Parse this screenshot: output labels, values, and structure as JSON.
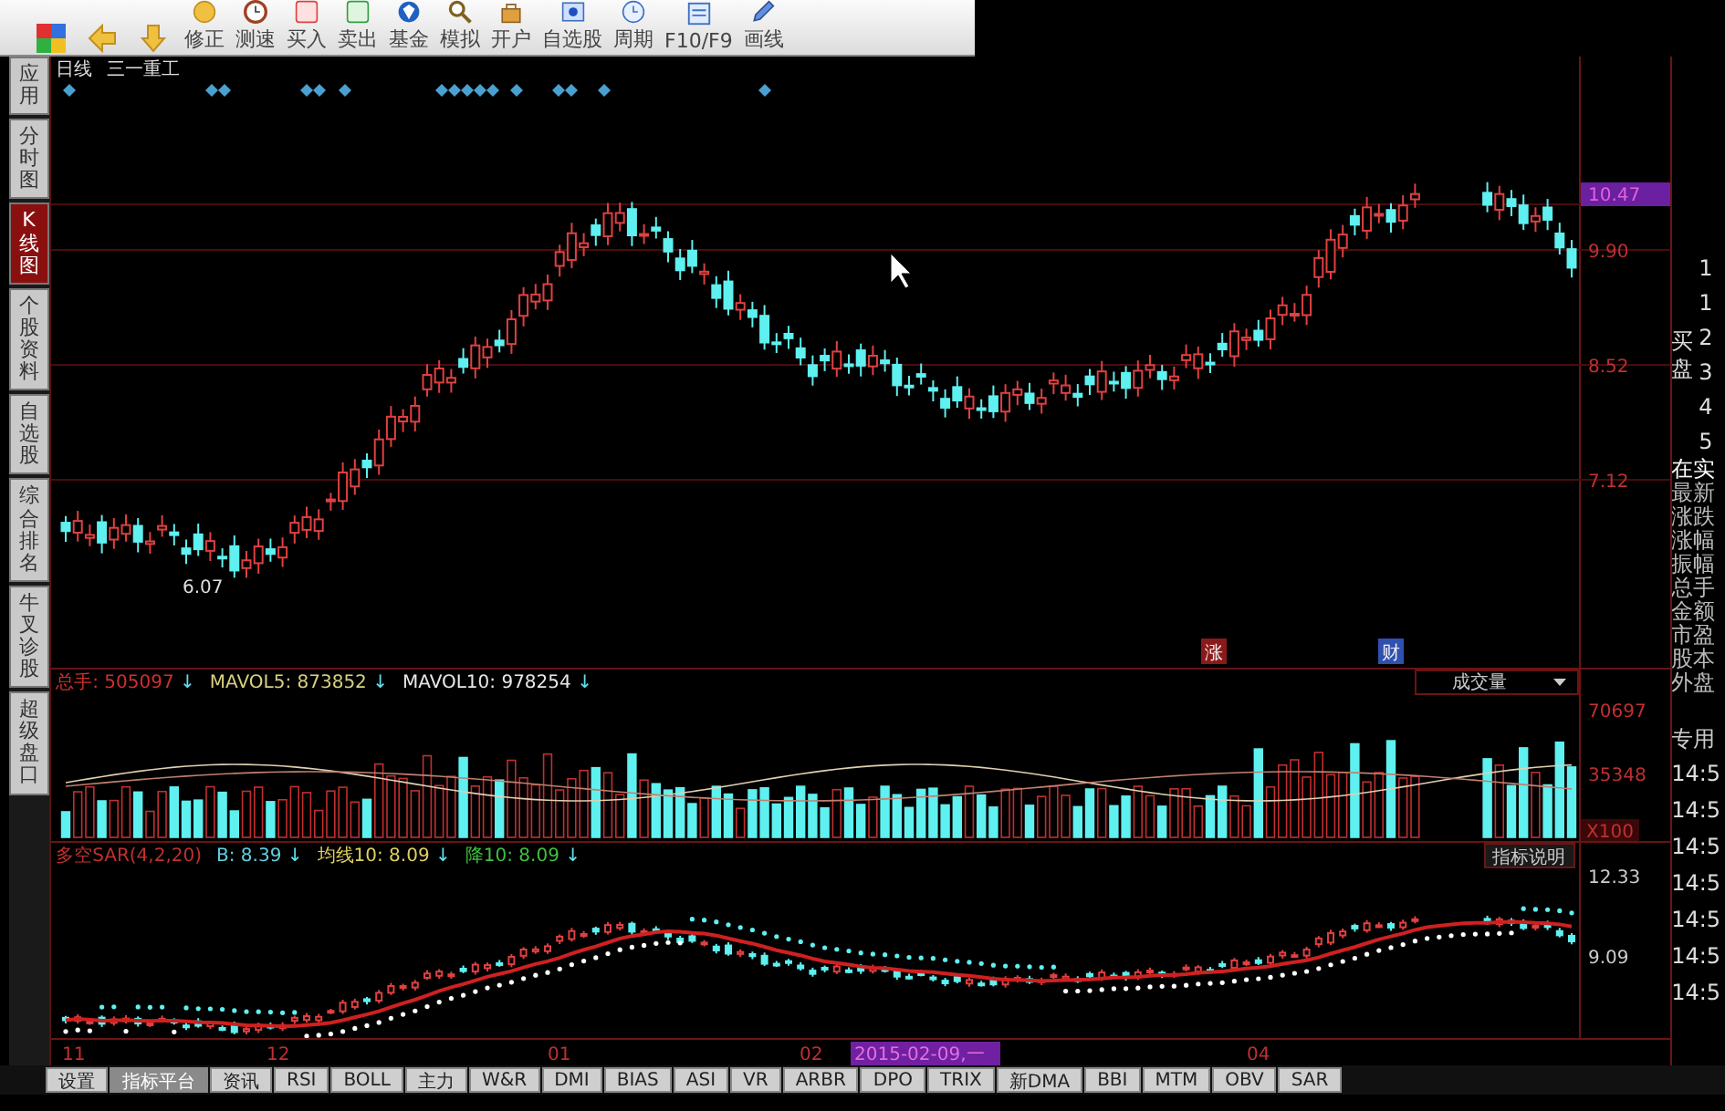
{
  "toolbar": {
    "buttons": [
      {
        "kind": "grid"
      },
      {
        "kind": "back"
      },
      {
        "kind": "updown"
      },
      {
        "kind": "fix",
        "label": "修正"
      },
      {
        "kind": "speed",
        "label": "测速"
      },
      {
        "kind": "buy",
        "label": "买入"
      },
      {
        "kind": "sell",
        "label": "卖出"
      },
      {
        "kind": "fund",
        "label": "基金"
      },
      {
        "kind": "sim",
        "label": "模拟"
      },
      {
        "kind": "account",
        "label": "开户"
      },
      {
        "kind": "watch",
        "label": "自选股"
      },
      {
        "kind": "period",
        "label": "周期"
      },
      {
        "kind": "f10",
        "label": "F10/F9"
      },
      {
        "kind": "draw",
        "label": "画线"
      }
    ]
  },
  "side_tabs": [
    {
      "label": "应用",
      "selected": false
    },
    {
      "label": "分时图",
      "selected": false
    },
    {
      "label": "K线图",
      "selected": true
    },
    {
      "label": "个股资料",
      "selected": false
    },
    {
      "label": "自选股",
      "selected": false
    },
    {
      "label": "综合排名",
      "selected": false
    },
    {
      "label": "牛叉诊股",
      "selected": false
    },
    {
      "label": "超级盘口",
      "selected": false
    }
  ],
  "chart": {
    "period": "日线",
    "stock": "三一重工",
    "price_axis": [
      "10.47",
      "9.90",
      "8.52",
      "7.12"
    ],
    "low_label": "6.07",
    "event_badges": [
      {
        "label": "涨",
        "color": "#8a1a1a"
      },
      {
        "label": "财",
        "color": "#3050b0"
      }
    ]
  },
  "volume": {
    "legend": [
      {
        "label": "总手:",
        "value": "505097",
        "arrow": "↓",
        "color": "#d03030"
      },
      {
        "label": "MAVOL5:",
        "value": "873852",
        "arrow": "↓",
        "color": "#d8d080"
      },
      {
        "label": "MAVOL10:",
        "value": "978254",
        "arrow": "↓",
        "color": "#e8e8e8"
      }
    ],
    "selector": "成交量",
    "axis": [
      "70697",
      "35348",
      "X100"
    ]
  },
  "sar": {
    "legend": [
      {
        "label": "多空SAR(4,2,20)",
        "color": "#c03030"
      },
      {
        "label": "B:",
        "value": "8.39",
        "arrow": "↓",
        "color": "#60d0e0"
      },
      {
        "label": "均线10:",
        "value": "8.09",
        "arrow": "↓",
        "color": "#e0d060"
      },
      {
        "label": "降10:",
        "value": "8.09",
        "arrow": "↓",
        "color": "#40c040"
      }
    ],
    "help_button": "指标说明",
    "axis": [
      "12.33",
      "9.09"
    ]
  },
  "x_axis": {
    "labels": [
      "11",
      "12",
      "01",
      "02",
      "04"
    ],
    "cursor_date": "2015-02-09,一"
  },
  "indicator_tabs": [
    {
      "label": "设置",
      "selected": false
    },
    {
      "label": "指标平台",
      "selected": true
    },
    {
      "label": "资讯",
      "selected": false
    },
    {
      "label": "RSI",
      "selected": false
    },
    {
      "label": "BOLL",
      "selected": false
    },
    {
      "label": "主力",
      "selected": false
    },
    {
      "label": "W&R",
      "selected": false
    },
    {
      "label": "DMI",
      "selected": false
    },
    {
      "label": "BIAS",
      "selected": false
    },
    {
      "label": "ASI",
      "selected": false
    },
    {
      "label": "VR",
      "selected": false
    },
    {
      "label": "ARBR",
      "selected": false
    },
    {
      "label": "DPO",
      "selected": false
    },
    {
      "label": "TRIX",
      "selected": false
    },
    {
      "label": "新DMA",
      "selected": false
    },
    {
      "label": "BBI",
      "selected": false
    },
    {
      "label": "MTM",
      "selected": false
    },
    {
      "label": "OBV",
      "selected": false
    },
    {
      "label": "SAR",
      "selected": false
    }
  ],
  "side_panel": {
    "bid_label": "买盘",
    "bid_rows": [
      "1",
      "1",
      "2",
      "3",
      "4",
      "5"
    ],
    "section": "在实",
    "quote_labels": [
      "最新",
      "涨跌",
      "涨幅",
      "振幅",
      "总手",
      "金额",
      "市盈",
      "股本",
      "外盘"
    ],
    "section_2": "专用",
    "times": [
      "14:5",
      "14:5",
      "14:5",
      "14:5",
      "14:5",
      "14:5",
      "14:5"
    ]
  }
}
